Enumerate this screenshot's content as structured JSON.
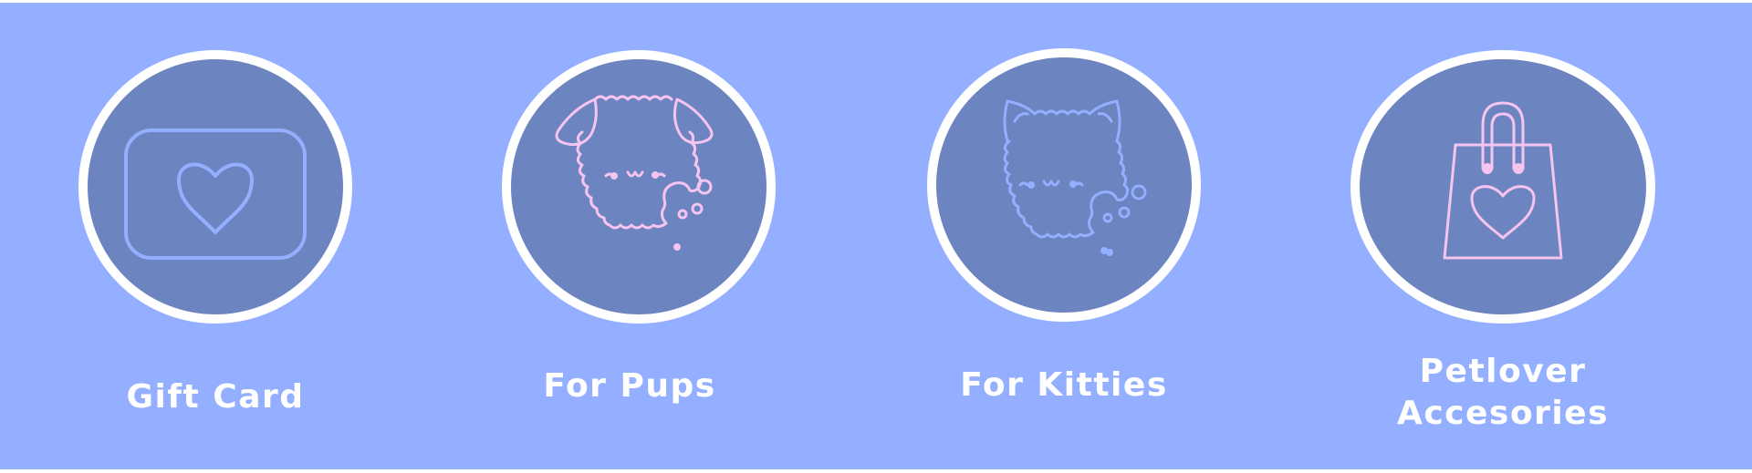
{
  "colors": {
    "background": "#94afff",
    "circle_fill": "#6c84bf",
    "circle_border": "#ffffff",
    "icon_blue": "#94afff",
    "icon_pink": "#f6c4f1",
    "label_text": "#ffffff"
  },
  "categories": [
    {
      "label": "Gift Card",
      "icon": "gift-card-icon"
    },
    {
      "label": "For Pups",
      "icon": "puppy-icon"
    },
    {
      "label": "For Kitties",
      "icon": "kitten-icon"
    },
    {
      "label_line1": "Petlover",
      "label_line2": "Accesories",
      "icon": "shopping-bag-icon"
    }
  ]
}
